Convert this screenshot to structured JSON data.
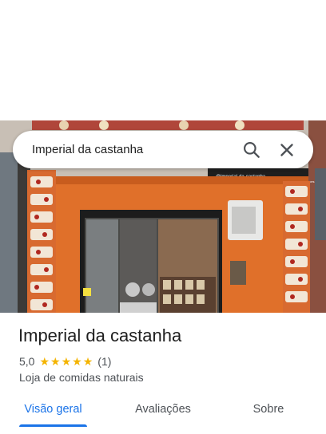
{
  "search": {
    "query": "Imperial da castanha"
  },
  "place": {
    "name": "Imperial da castanha",
    "rating_value": "5,0",
    "rating_stars": 5,
    "review_count": "(1)",
    "category": "Loja de comidas naturais"
  },
  "storefront_sign": {
    "handle": "@imperial-da-castanha",
    "tagline": "Avelãs · Castanhas · Doces"
  },
  "tabs": [
    {
      "label": "Visão geral",
      "active": true
    },
    {
      "label": "Avaliações",
      "active": false
    },
    {
      "label": "Sobre",
      "active": false
    }
  ],
  "colors": {
    "accent": "#1a73e8",
    "star": "#f4b400",
    "storefront": "#e0702a"
  },
  "icons": {
    "search": "search-icon",
    "close": "close-icon",
    "star": "star-icon"
  }
}
